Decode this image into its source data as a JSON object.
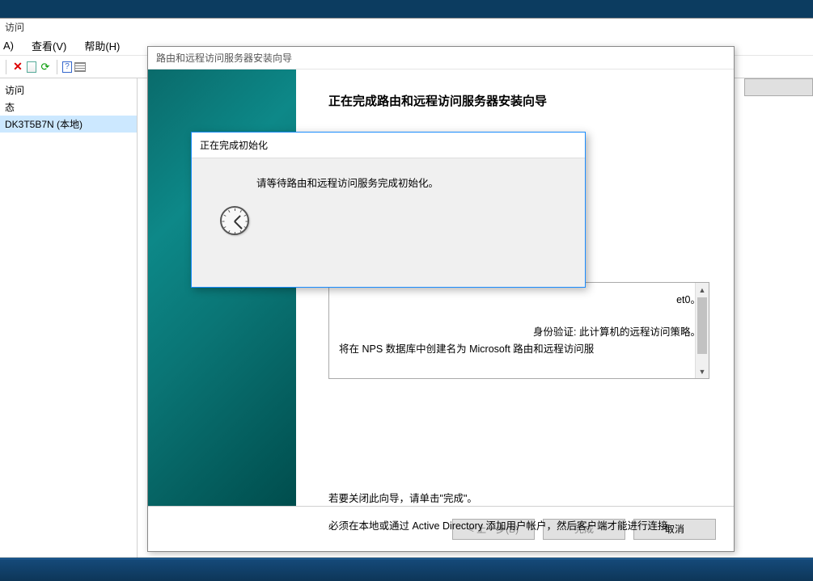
{
  "mmc": {
    "title_fragment": "访问",
    "menu": {
      "item1": "A)",
      "view": "查看(V)",
      "help": "帮助(H)"
    },
    "tree": {
      "item1": "访问",
      "item2": "态",
      "item3": "DK3T5B7N (本地)"
    }
  },
  "wizard": {
    "title": "路由和远程访问服务器安装向导",
    "heading": "正在完成路由和远程访问服务器安装向导",
    "box_line1": "et0。",
    "box_line2": "身份验证: 此计算机的远程访问策略。",
    "box_line3": "将在 NPS 数据库中创建名为 Microsoft 路由和远程访问服",
    "foot_text": "必须在本地或通过 Active Directory 添加用户帐户，然后客户端才能进行连接。",
    "close_text": "若要关闭此向导，请单击\"完成\"。",
    "buttons": {
      "back": "< 上一步(B)",
      "finish": "完成",
      "cancel": "取消"
    }
  },
  "init_dialog": {
    "title": "正在完成初始化",
    "message": "请等待路由和远程访问服务完成初始化。"
  }
}
